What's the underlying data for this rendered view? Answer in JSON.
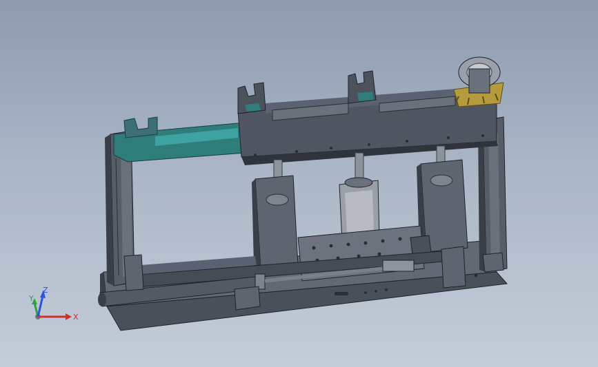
{
  "viewport": {
    "background_top": "#8d9bb0",
    "background_bottom": "#c4ccd8"
  },
  "colors": {
    "frame": "#4f5561",
    "frame_dark": "#2f343c",
    "rail": "#5b616b",
    "teal_bracket": "#2f7d7b",
    "block": "#5e6570",
    "shaft": "#8d939b",
    "gold_gear": "#b59b3c",
    "axis_x": "#d0302c",
    "axis_y": "#2ea043",
    "axis_z": "#2b55d8"
  },
  "triad": {
    "x_label": "X",
    "y_label": "Y",
    "z_label": "Z"
  }
}
